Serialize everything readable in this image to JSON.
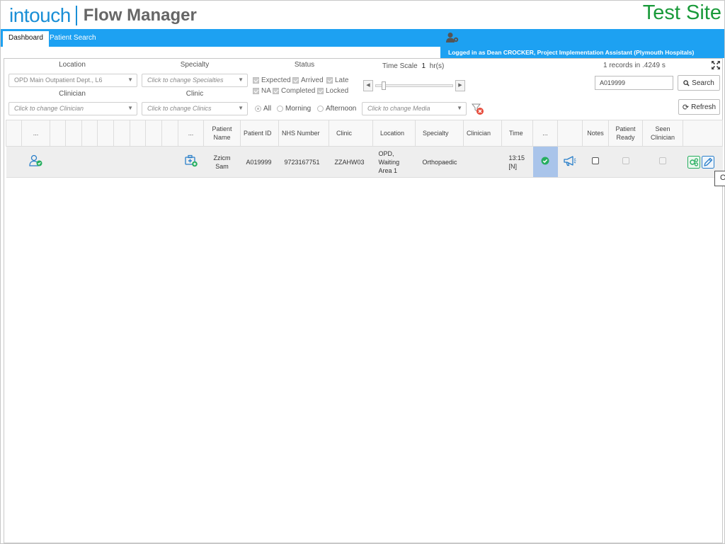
{
  "app": {
    "logo_left": "intouch",
    "logo_right": "Flow Manager",
    "site_title": "Test Site"
  },
  "nav": {
    "tabs": [
      {
        "label": "Dashboard",
        "active": true
      },
      {
        "label": "Patient Search",
        "active": false
      }
    ],
    "login_text": "Logged in as Dean CROCKER, Project Implementation Assistant (Plymouth Hospitals)"
  },
  "filters": {
    "location": {
      "label": "Location",
      "value": "OPD Main Outpatient Dept., L6"
    },
    "specialty": {
      "label": "Specialty",
      "placeholder": "Click to change Specialties"
    },
    "clinician": {
      "label": "Clinician",
      "placeholder": "Click to change Clinician"
    },
    "clinic": {
      "label": "Clinic",
      "placeholder": "Click to change Clinics"
    },
    "status": {
      "label": "Status",
      "options": [
        "Expected",
        "Arrived",
        "Late",
        "NA",
        "Completed",
        "Locked"
      ]
    },
    "session": {
      "options": [
        "All",
        "Morning",
        "Afternoon"
      ],
      "selected": "All"
    },
    "media": {
      "placeholder": "Click to change Media"
    },
    "time_scale": {
      "label": "Time Scale",
      "value": "1",
      "unit": "hr(s)"
    }
  },
  "search": {
    "records_text": "1 records in .4249 s",
    "input_value": "A019999",
    "search_label": "Search",
    "refresh_label": "Refresh"
  },
  "table": {
    "headers": {
      "dots1": "...",
      "dots2": "...",
      "patient_name": "Patient Name",
      "patient_id": "Patient ID",
      "nhs_number": "NHS Number",
      "clinic": "Clinic",
      "location": "Location",
      "specialty": "Specialty",
      "clinician": "Clinician",
      "time": "Time",
      "dots3": "...",
      "notes": "Notes",
      "patient_ready": "Patient Ready",
      "seen_clinician": "Seen Clinician"
    },
    "rows": [
      {
        "patient_name": "Zzicm Sam",
        "patient_id": "A019999",
        "nhs_number": "9723167751",
        "clinic": "ZZAHW03",
        "location": "OPD, Waiting Area 1",
        "specialty": "Orthopaedic",
        "clinician": "",
        "time": "13:15 [N]"
      }
    ]
  },
  "tooltip": {
    "text": "O"
  },
  "colors": {
    "brand_blue": "#1da1f2",
    "logo_blue": "#1a8fd6",
    "site_green": "#1a9a3a",
    "status_green": "#27ae60",
    "highlight_cell": "#a9c4ea"
  }
}
